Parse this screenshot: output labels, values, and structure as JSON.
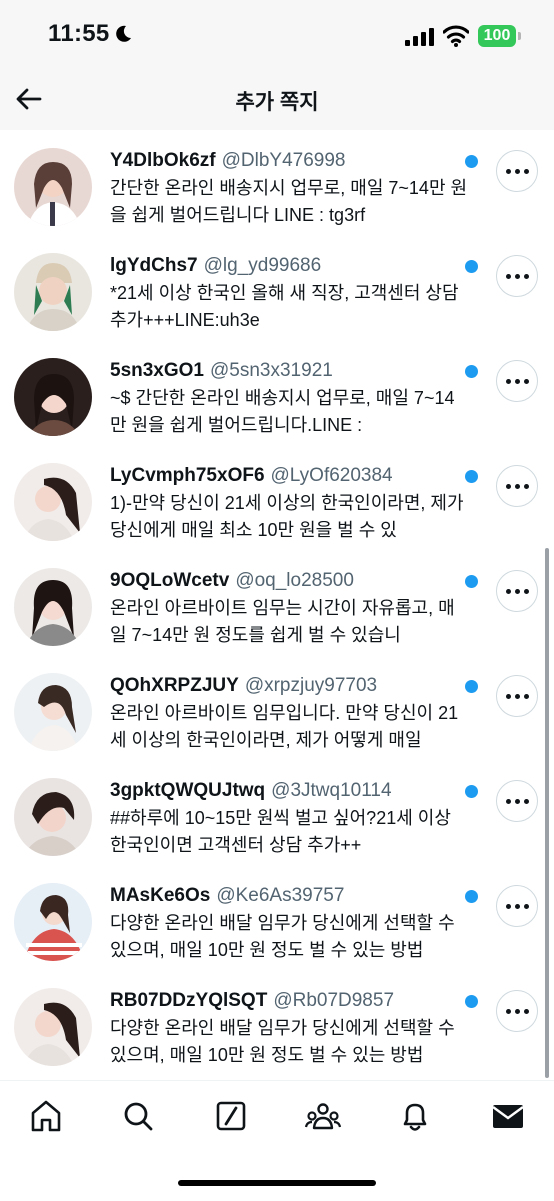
{
  "status_bar": {
    "time": "11:55",
    "battery": "100"
  },
  "header": {
    "title": "추가 쪽지"
  },
  "messages": [
    {
      "name": "Y4DlbOk6zf",
      "handle": "@DlbY476998",
      "text": "간단한 온라인 배송지시 업무로, 매일 7~14만 원을 쉽게 벌어드립니다 LINE : tg3rf",
      "unread": true
    },
    {
      "name": "lgYdChs7",
      "handle": "@lg_yd99686",
      "text": "*21세 이상 한국인 올해 새 직장, 고객센터 상담 추가+++LINE:uh3e",
      "unread": true
    },
    {
      "name": "5sn3xGO1",
      "handle": "@5sn3x31921",
      "text": "~$ 간단한 온라인 배송지시 업무로, 매일 7~14만 원을 쉽게 벌어드립니다.LINE :",
      "unread": true
    },
    {
      "name": "LyCvmph75xOF6",
      "handle": "@LyOf620384",
      "text": "1)-만약 당신이 21세 이상의 한국인이라면, 제가 당신에게 매일 최소 10만 원을 벌 수 있",
      "unread": true
    },
    {
      "name": "9OQLoWcetv",
      "handle": "@oq_lo28500",
      "text": "온라인 아르바이트 임무는 시간이 자유롭고, 매일 7~14만 원 정도를 쉽게 벌 수 있습니",
      "unread": true
    },
    {
      "name": "QOhXRPZJUY",
      "handle": "@xrpzjuy97703",
      "text": "온라인 아르바이트 임무입니다. 만약 당신이 21세 이상의 한국인이라면, 제가 어떻게 매일",
      "unread": true
    },
    {
      "name": "3gpktQWQUJtwq",
      "handle": "@3Jtwq10114",
      "text": "##하루에 10~15만 원씩 벌고 싶어?21세 이상 한국인이면 고객센터 상담 추가++",
      "unread": true
    },
    {
      "name": "MAsKe6Os",
      "handle": "@Ke6As39757",
      "text": "다양한 온라인 배달 임무가 당신에게 선택할 수 있으며, 매일 10만 원 정도 벌 수 있는 방법",
      "unread": true
    },
    {
      "name": "RB07DDzYQlSQT",
      "handle": "@Rb07D9857",
      "text": "다양한 온라인 배달 임무가 당신에게 선택할 수 있으며, 매일 10만 원 정도 벌 수 있는 방법",
      "unread": true
    }
  ],
  "tabs": [
    "home-icon",
    "search-icon",
    "grok-icon",
    "communities-icon",
    "notifications-icon",
    "messages-icon"
  ],
  "colors": {
    "accent": "#1d9bf0",
    "text": "#0f1419",
    "secondary": "#536471",
    "battery": "#34c759"
  }
}
